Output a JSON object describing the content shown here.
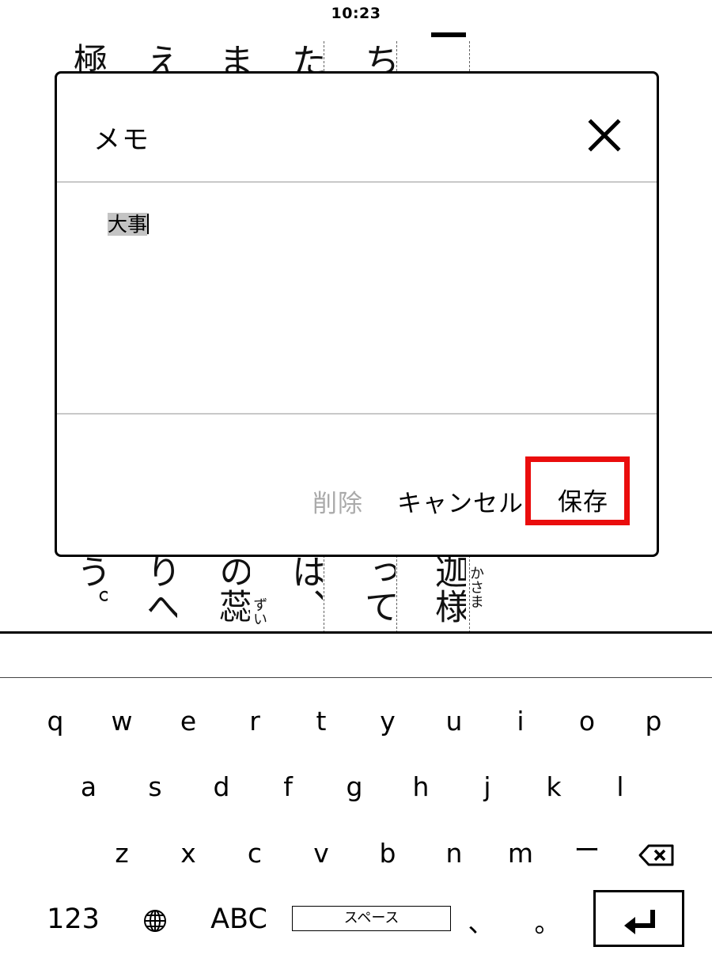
{
  "status_bar": {
    "time": "10:23"
  },
  "book": {
    "columns_top": [
      {
        "text": "極"
      },
      {
        "text": "え"
      },
      {
        "text": "ま"
      },
      {
        "text": "た"
      },
      {
        "text": "ち"
      }
    ],
    "columns_bottom": [
      {
        "text": "う。"
      },
      {
        "text": "りへ"
      },
      {
        "text": "の蕊"
      },
      {
        "text": "は、"
      },
      {
        "text": "って"
      },
      {
        "text": "迦様"
      }
    ],
    "ruby": [
      {
        "text": "ずい"
      },
      {
        "text": "かさま"
      }
    ]
  },
  "dialog": {
    "title": "メモ",
    "memo_text": "大事",
    "buttons": {
      "delete": "削除",
      "cancel": "キャンセル",
      "save": "保存"
    }
  },
  "keyboard": {
    "row1": [
      "q",
      "w",
      "e",
      "r",
      "t",
      "y",
      "u",
      "i",
      "o",
      "p"
    ],
    "row2": [
      "a",
      "s",
      "d",
      "f",
      "g",
      "h",
      "j",
      "k",
      "l"
    ],
    "row3": [
      "z",
      "x",
      "c",
      "v",
      "b",
      "n",
      "m",
      "ー"
    ],
    "numbers_key": "123",
    "abc_key": "ABC",
    "space_key": "スペース",
    "comma_key": "、",
    "period_key": "。",
    "icons": {
      "globe": "globe-icon",
      "backspace": "backspace-icon",
      "enter": "enter-icon",
      "close": "close-icon"
    }
  },
  "colors": {
    "highlight_box": "#ea0d0d",
    "selection": "#c4c4c4",
    "disabled_text": "#aaaaaa"
  }
}
